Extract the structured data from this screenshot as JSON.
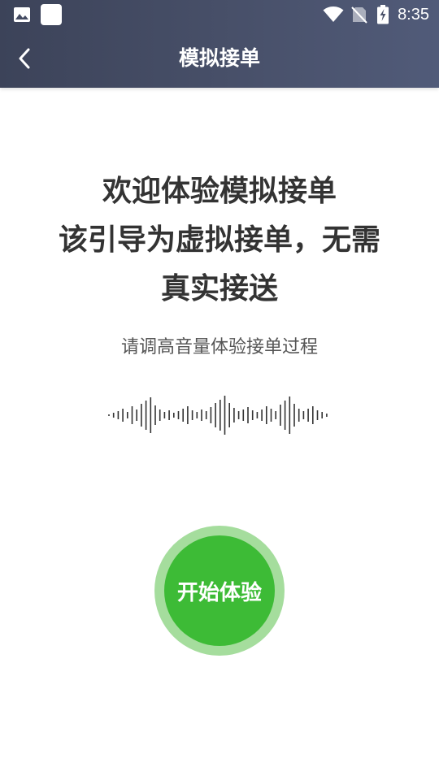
{
  "status_bar": {
    "time": "8:35",
    "left_icons": [
      "gallery-icon",
      "app-square-icon"
    ],
    "right_icons": [
      "wifi-icon",
      "no-sim-icon",
      "battery-charging-icon"
    ]
  },
  "header": {
    "title": "模拟接单",
    "back_icon": "chevron-left-icon",
    "colors": {
      "gradient_start": "#3c4359",
      "gradient_end": "#515b79"
    }
  },
  "main": {
    "headline_lines": [
      "欢迎体验模拟接单",
      "该引导为虚拟接单，无需",
      "真实接送"
    ],
    "subtitle": "请调高音量体验接单过程",
    "waveform_icon": "sound-wave-icon",
    "start_button": {
      "label": "开始体验",
      "colors": {
        "inner": "#3dbb36",
        "ring": "#a5dd9d"
      }
    }
  }
}
